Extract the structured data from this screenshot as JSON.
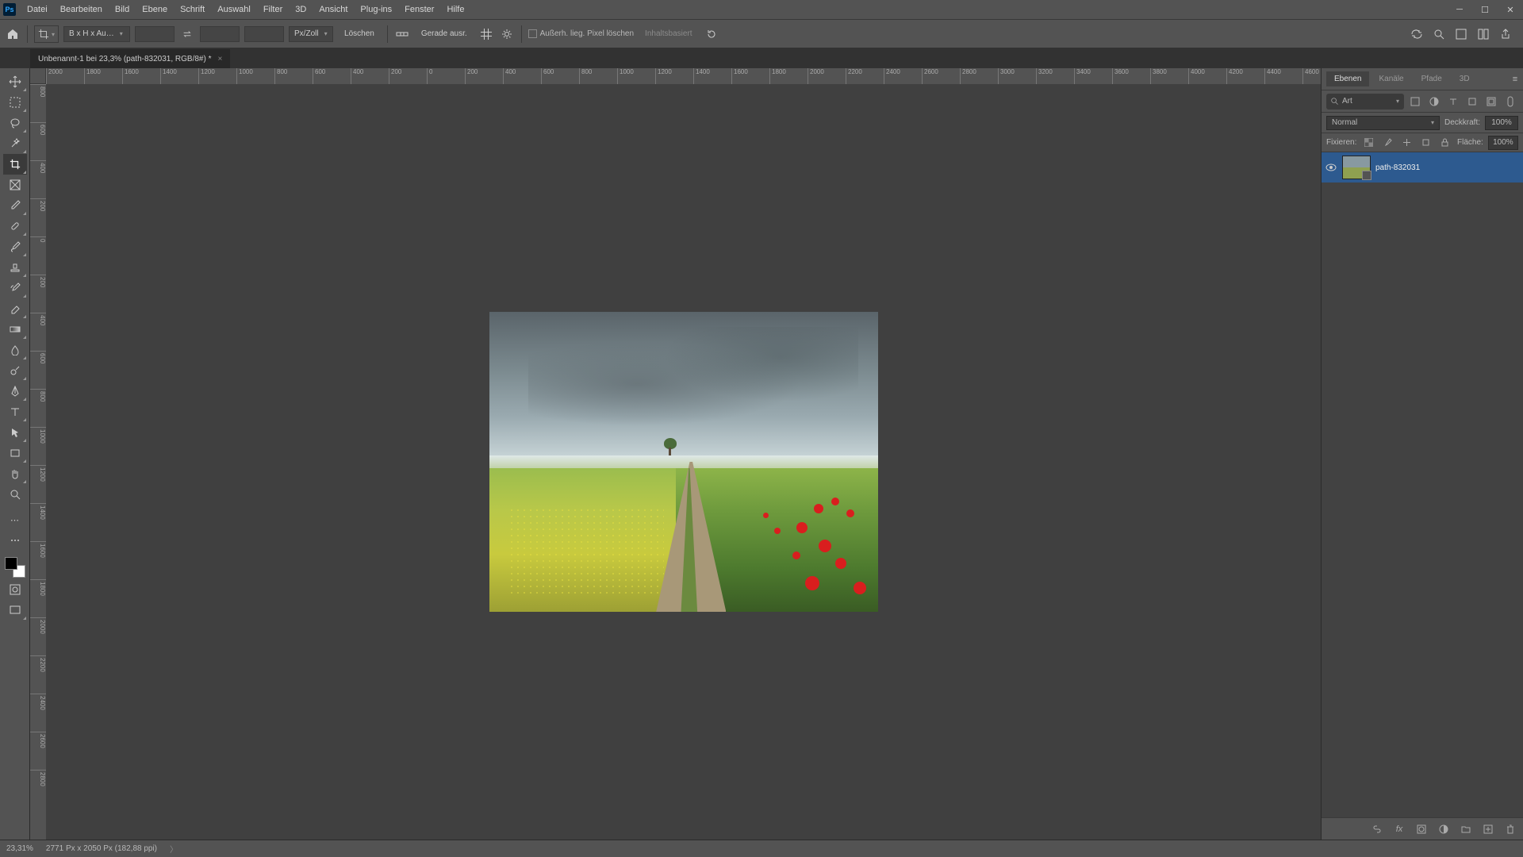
{
  "app": {
    "icon_label": "Ps"
  },
  "menu": [
    "Datei",
    "Bearbeiten",
    "Bild",
    "Ebene",
    "Schrift",
    "Auswahl",
    "Filter",
    "3D",
    "Ansicht",
    "Plug-ins",
    "Fenster",
    "Hilfe"
  ],
  "options": {
    "ratio_preset": "B x H x Au…",
    "unit": "Px/Zoll",
    "clear": "Löschen",
    "straighten": "Gerade ausr.",
    "delete_cropped": "Außerh. lieg. Pixel löschen",
    "content_aware": "Inhaltsbasiert"
  },
  "document_tab": {
    "title": "Unbenannt-1 bei 23,3% (path-832031, RGB/8#) *"
  },
  "ruler_h": [
    "2000",
    "1800",
    "1600",
    "1400",
    "1200",
    "1000",
    "800",
    "600",
    "400",
    "200",
    "0",
    "200",
    "400",
    "600",
    "800",
    "1000",
    "1200",
    "1400",
    "1600",
    "1800",
    "2000",
    "2200",
    "2400",
    "2600",
    "2800",
    "3000",
    "3200",
    "3400",
    "3600",
    "3800",
    "4000",
    "4200",
    "4400",
    "4600"
  ],
  "ruler_v": [
    "800",
    "600",
    "400",
    "200",
    "0",
    "200",
    "400",
    "600",
    "800",
    "1000",
    "1200",
    "1400",
    "1600",
    "1800",
    "2000",
    "2200",
    "2400",
    "2600",
    "2800"
  ],
  "panels": {
    "tabs": [
      "Ebenen",
      "Kanäle",
      "Pfade",
      "3D"
    ],
    "active_tab": "Ebenen",
    "search_label": "Art",
    "blend_mode": "Normal",
    "opacity_label": "Deckkraft:",
    "opacity_value": "100%",
    "lock_label": "Fixieren:",
    "fill_label": "Fläche:",
    "fill_value": "100%",
    "layer": {
      "name": "path-832031"
    }
  },
  "status": {
    "zoom": "23,31%",
    "doc_info": "2771 Px x 2050 Px (182,88 ppi)"
  }
}
